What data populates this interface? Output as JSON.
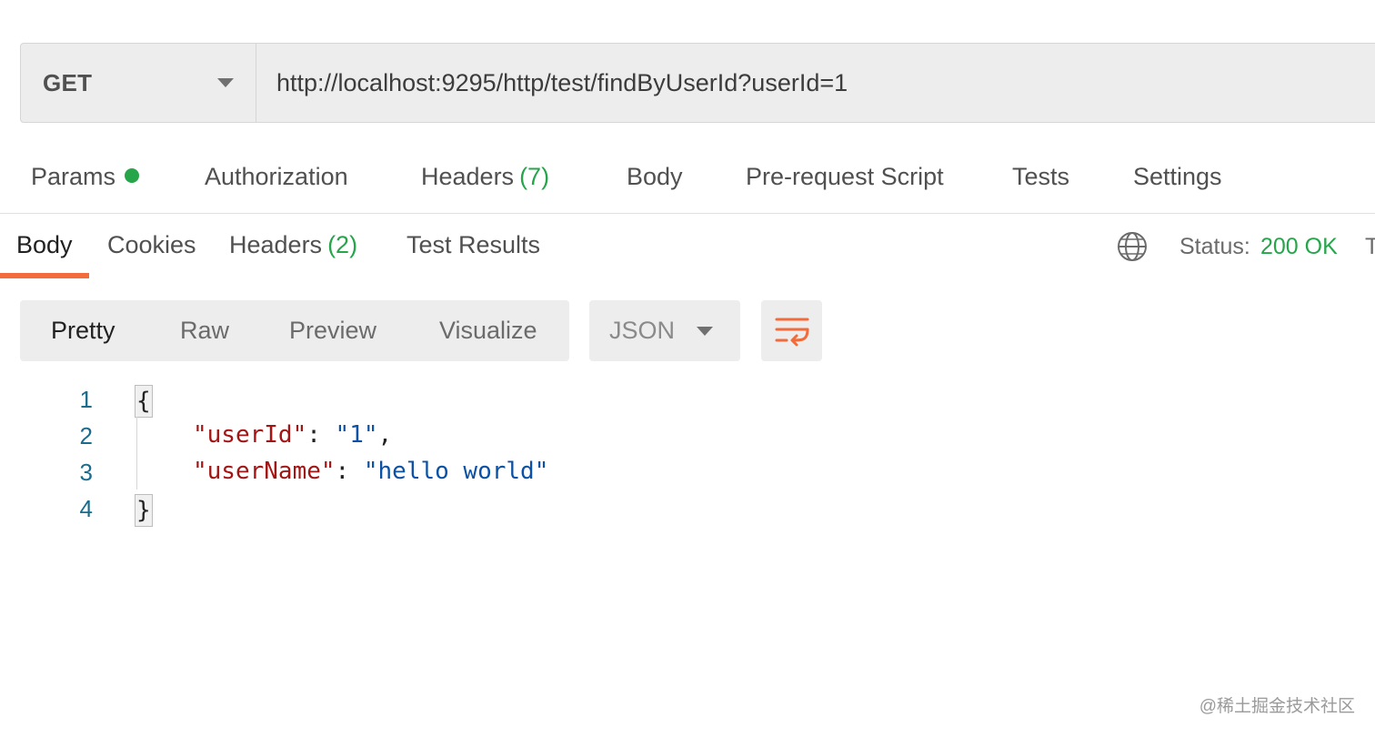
{
  "request": {
    "method": "GET",
    "url": "http://localhost:9295/http/test/findByUserId?userId=1"
  },
  "request_tabs": {
    "params": "Params",
    "authorization": "Authorization",
    "headers": "Headers",
    "headers_count": "(7)",
    "body": "Body",
    "pre_request_script": "Pre-request Script",
    "tests": "Tests",
    "settings": "Settings"
  },
  "response_tabs": {
    "body": "Body",
    "cookies": "Cookies",
    "headers": "Headers",
    "headers_count": "(2)",
    "test_results": "Test Results",
    "active": "Body"
  },
  "response_status": {
    "label": "Status:",
    "value": "200 OK",
    "truncated_next": "T"
  },
  "view_modes": {
    "pretty": "Pretty",
    "raw": "Raw",
    "preview": "Preview",
    "visualize": "Visualize",
    "active": "Pretty"
  },
  "format": {
    "selected": "JSON"
  },
  "code": {
    "line_numbers": [
      "1",
      "2",
      "3",
      "4"
    ],
    "open_brace": "{",
    "close_brace": "}",
    "key1": "\"userId\"",
    "value1": "\"1\"",
    "key2": "\"userName\"",
    "value2": "\"hello world\"",
    "colon": ": ",
    "comma": ","
  },
  "icons": {
    "method_caret": "chevron-down-icon",
    "globe": "globe-icon",
    "format_caret": "chevron-down-icon",
    "wrap": "wrap-lines-icon"
  },
  "colors": {
    "accent": "#f26b3a",
    "success": "#26a54a",
    "json_key": "#a31515",
    "json_string": "#0b51a6",
    "line_number": "#1a6b8c"
  },
  "watermark": "@稀土掘金技术社区"
}
